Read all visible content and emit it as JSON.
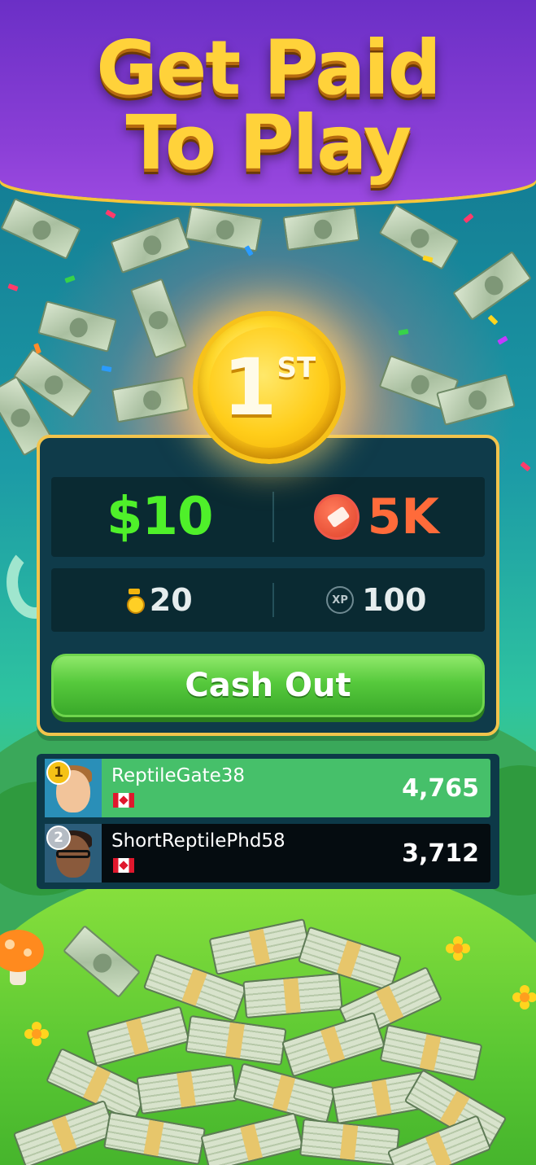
{
  "headline": {
    "line1": "Get Paid",
    "line2": "To Play"
  },
  "placement": {
    "number": "1",
    "suffix": "ST"
  },
  "rewards": {
    "cash": "$10",
    "tickets": "5K",
    "medals": "20",
    "xp_label": "XP",
    "xp": "100"
  },
  "cashout_button": {
    "label": "Cash Out"
  },
  "leaderboard": [
    {
      "rank": "1",
      "name": "ReptileGate38",
      "score": "4,765"
    },
    {
      "rank": "2",
      "name": "ShortReptilePhd58",
      "score": "3,712"
    }
  ],
  "colors": {
    "banner": "#8a3fd6",
    "headline": "#ffd23a",
    "cash": "#4ff02a",
    "tickets": "#ff6b3a",
    "button": "#56c93c",
    "card_border": "#f2c44c",
    "leader_row": "#46c06a"
  },
  "icons": {
    "ticket": "ticket-icon",
    "medal": "medal-icon",
    "xp": "xp-icon",
    "flag": "canada-flag-icon"
  }
}
